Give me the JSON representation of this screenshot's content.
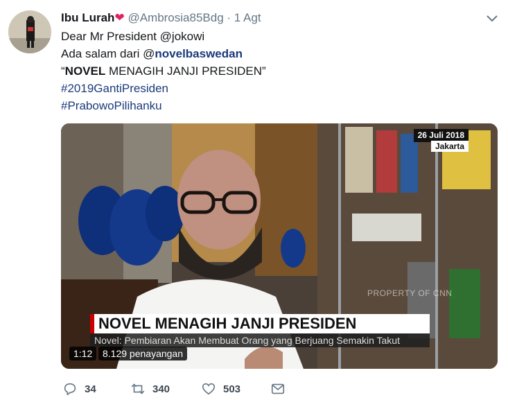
{
  "tweet": {
    "author_name": "Ibu Lurah",
    "author_heart": "❤",
    "handle": "@Ambrosia85Bdg",
    "separator": "·",
    "time": "1 Agt",
    "lines": {
      "l1_prefix": "Dear Mr President ",
      "l1_mention": "@jokowi",
      "l2_prefix": "Ada salam dari ",
      "l2_mention_at": "@",
      "l2_mention_name": "novelbaswedan",
      "l3_quote_open": "“",
      "l3_bold": "NOVEL",
      "l3_rest": " MENAGIH JANJI PRESIDEN”",
      "hashtag1": "#2019GantiPresiden",
      "hashtag2": "#PrabowoPilihanku"
    }
  },
  "media": {
    "date_badge": "26 Juli 2018",
    "location_badge": "Jakarta",
    "watermark": "PROPERTY OF CNN",
    "headline": "NOVEL MENAGIH JANJI PRESIDEN",
    "subline": "Novel: Pembiaran Akan Membuat Orang yang Berjuang Semakin Takut",
    "duration": "1:12",
    "views": "8.129 penayangan"
  },
  "actions": {
    "reply_count": "34",
    "retweet_count": "340",
    "like_count": "503"
  },
  "icons": [
    "chevron-down-icon",
    "reply-icon",
    "retweet-icon",
    "like-icon",
    "message-icon"
  ],
  "colors": {
    "heart": "#e0245e",
    "link": "#1b3a7a",
    "muted": "#657786",
    "headline_accent": "#cc0000"
  }
}
